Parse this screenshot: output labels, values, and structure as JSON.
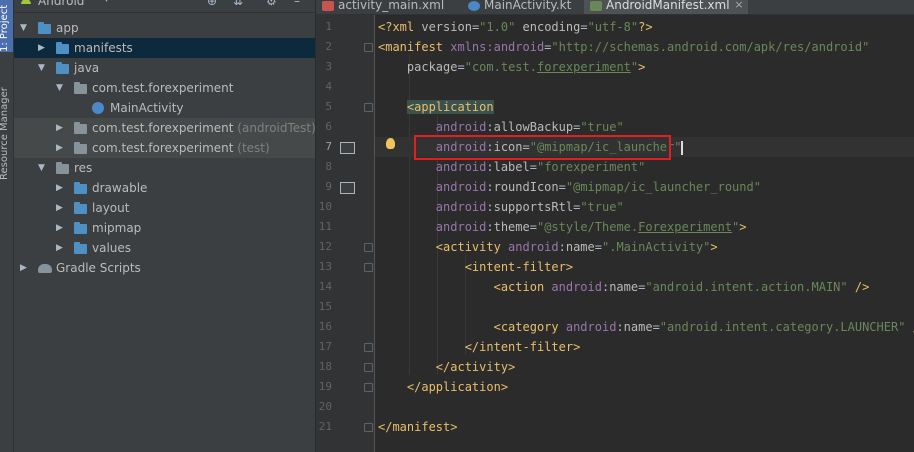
{
  "side_stripe": {
    "project_tab": "1: Project",
    "resource_manager_tab": "Resource Manager"
  },
  "project_panel": {
    "view_selector": "Android",
    "icons": [
      "globe-icon",
      "collapse-icon",
      "gear-icon",
      "hide-icon"
    ],
    "tree": [
      {
        "label": "app",
        "sub": "",
        "depth": 0,
        "expanded": true,
        "icon": "module-folder-icon",
        "state": "normal"
      },
      {
        "label": "manifests",
        "sub": "",
        "depth": 1,
        "expanded": false,
        "icon": "folder-icon",
        "state": "selected"
      },
      {
        "label": "java",
        "sub": "",
        "depth": 1,
        "expanded": true,
        "icon": "folder-icon",
        "state": "normal"
      },
      {
        "label": "com.test.forexperiment",
        "sub": "",
        "depth": 2,
        "expanded": true,
        "icon": "package-icon",
        "state": "normal"
      },
      {
        "label": "MainActivity",
        "sub": "",
        "depth": 3,
        "expanded": null,
        "icon": "kotlin-class-icon",
        "state": "normal"
      },
      {
        "label": "com.test.forexperiment",
        "sub": "(androidTest)",
        "depth": 2,
        "expanded": false,
        "icon": "package-icon",
        "state": "gray"
      },
      {
        "label": "com.test.forexperiment",
        "sub": "(test)",
        "depth": 2,
        "expanded": false,
        "icon": "package-icon",
        "state": "gray"
      },
      {
        "label": "res",
        "sub": "",
        "depth": 1,
        "expanded": true,
        "icon": "res-folder-icon",
        "state": "normal"
      },
      {
        "label": "drawable",
        "sub": "",
        "depth": 2,
        "expanded": false,
        "icon": "folder-icon",
        "state": "normal"
      },
      {
        "label": "layout",
        "sub": "",
        "depth": 2,
        "expanded": false,
        "icon": "folder-icon",
        "state": "normal"
      },
      {
        "label": "mipmap",
        "sub": "",
        "depth": 2,
        "expanded": false,
        "icon": "folder-icon",
        "state": "normal"
      },
      {
        "label": "values",
        "sub": "",
        "depth": 2,
        "expanded": false,
        "icon": "folder-icon",
        "state": "normal"
      },
      {
        "label": "Gradle Scripts",
        "sub": "",
        "depth": 0,
        "expanded": false,
        "icon": "gradle-icon",
        "state": "normal"
      }
    ]
  },
  "tabs": [
    {
      "label": "activity_main.xml",
      "icon": "xml-layout-icon",
      "active": false
    },
    {
      "label": "MainActivity.kt",
      "icon": "kotlin-file-icon",
      "active": false
    },
    {
      "label": "AndroidManifest.xml",
      "icon": "manifest-icon",
      "active": true
    }
  ],
  "colors": {
    "tag": "#e8bf6a",
    "namespace": "#9876aa",
    "attribute": "#bababa",
    "value": "#6a8759",
    "highlight_border": "#e02020",
    "selection": "#0d293e"
  },
  "code_lines": [
    {
      "n": "1",
      "parts": [
        [
          "t",
          "<?xml "
        ],
        [
          "at",
          "version"
        ],
        [
          "p",
          "="
        ],
        [
          "v",
          "\"1.0\""
        ],
        [
          "p",
          " "
        ],
        [
          "at",
          "encoding"
        ],
        [
          "p",
          "="
        ],
        [
          "v",
          "\"utf-8\""
        ],
        [
          "t",
          "?>"
        ]
      ]
    },
    {
      "n": "2",
      "parts": [
        [
          "t",
          "<manifest "
        ],
        [
          "ns",
          "xmlns:android"
        ],
        [
          "p",
          "="
        ],
        [
          "v",
          "\"http://schemas.android.com/apk/res/android\""
        ]
      ]
    },
    {
      "n": "3",
      "parts": [
        [
          "p",
          "    "
        ],
        [
          "at",
          "package"
        ],
        [
          "p",
          "="
        ],
        [
          "v",
          "\"com.test."
        ],
        [
          "vu",
          "forexperiment"
        ],
        [
          "v",
          "\""
        ],
        [
          "t",
          ">"
        ]
      ]
    },
    {
      "n": "4",
      "parts": []
    },
    {
      "n": "5",
      "parts": [
        [
          "p",
          "    "
        ],
        [
          "tb",
          "<application"
        ]
      ]
    },
    {
      "n": "6",
      "parts": [
        [
          "p",
          "        "
        ],
        [
          "ns",
          "android"
        ],
        [
          "p",
          ":"
        ],
        [
          "at",
          "allowBackup"
        ],
        [
          "p",
          "="
        ],
        [
          "v",
          "\"true\""
        ]
      ]
    },
    {
      "n": "7",
      "parts": [
        [
          "p",
          "        "
        ],
        [
          "ns",
          "android"
        ],
        [
          "p",
          ":"
        ],
        [
          "at",
          "icon"
        ],
        [
          "p",
          "="
        ],
        [
          "v",
          "\"@mipmap/ic_launcher\""
        ],
        [
          "caret",
          ""
        ]
      ]
    },
    {
      "n": "8",
      "parts": [
        [
          "p",
          "        "
        ],
        [
          "ns",
          "android"
        ],
        [
          "p",
          ":"
        ],
        [
          "at",
          "label"
        ],
        [
          "p",
          "="
        ],
        [
          "v",
          "\"forexperiment\""
        ]
      ]
    },
    {
      "n": "9",
      "parts": [
        [
          "p",
          "        "
        ],
        [
          "ns",
          "android"
        ],
        [
          "p",
          ":"
        ],
        [
          "at",
          "roundIcon"
        ],
        [
          "p",
          "="
        ],
        [
          "v",
          "\"@mipmap/ic_launcher_round\""
        ]
      ]
    },
    {
      "n": "10",
      "parts": [
        [
          "p",
          "        "
        ],
        [
          "ns",
          "android"
        ],
        [
          "p",
          ":"
        ],
        [
          "at",
          "supportsRtl"
        ],
        [
          "p",
          "="
        ],
        [
          "v",
          "\"true\""
        ]
      ]
    },
    {
      "n": "11",
      "parts": [
        [
          "p",
          "        "
        ],
        [
          "ns",
          "android"
        ],
        [
          "p",
          ":"
        ],
        [
          "at",
          "theme"
        ],
        [
          "p",
          "="
        ],
        [
          "v",
          "\"@style/Theme."
        ],
        [
          "vu",
          "Forexperiment"
        ],
        [
          "v",
          "\""
        ],
        [
          "t",
          ">"
        ]
      ]
    },
    {
      "n": "12",
      "parts": [
        [
          "p",
          "        "
        ],
        [
          "t",
          "<activity "
        ],
        [
          "ns",
          "android"
        ],
        [
          "p",
          ":"
        ],
        [
          "at",
          "name"
        ],
        [
          "p",
          "="
        ],
        [
          "v",
          "\".MainActivity\""
        ],
        [
          "t",
          ">"
        ]
      ]
    },
    {
      "n": "13",
      "parts": [
        [
          "p",
          "            "
        ],
        [
          "t",
          "<intent-filter>"
        ]
      ]
    },
    {
      "n": "14",
      "parts": [
        [
          "p",
          "                "
        ],
        [
          "t",
          "<action "
        ],
        [
          "ns",
          "android"
        ],
        [
          "p",
          ":"
        ],
        [
          "at",
          "name"
        ],
        [
          "p",
          "="
        ],
        [
          "v",
          "\"android.intent.action.MAIN\""
        ],
        [
          "p",
          " "
        ],
        [
          "t",
          "/>"
        ]
      ]
    },
    {
      "n": "15",
      "parts": []
    },
    {
      "n": "16",
      "parts": [
        [
          "p",
          "                "
        ],
        [
          "t",
          "<category "
        ],
        [
          "ns",
          "android"
        ],
        [
          "p",
          ":"
        ],
        [
          "at",
          "name"
        ],
        [
          "p",
          "="
        ],
        [
          "v",
          "\"android.intent.category.LAUNCHER\""
        ],
        [
          "p",
          " "
        ],
        [
          "t",
          "/>"
        ]
      ]
    },
    {
      "n": "17",
      "parts": [
        [
          "p",
          "            "
        ],
        [
          "t",
          "</intent-filter>"
        ]
      ]
    },
    {
      "n": "18",
      "parts": [
        [
          "p",
          "        "
        ],
        [
          "t",
          "</activity>"
        ]
      ]
    },
    {
      "n": "19",
      "parts": [
        [
          "p",
          "    "
        ],
        [
          "t",
          "</application>"
        ]
      ]
    },
    {
      "n": "20",
      "parts": []
    },
    {
      "n": "21",
      "parts": [
        [
          "t",
          "</manifest>"
        ]
      ]
    }
  ],
  "gutter_icons": {
    "7": "image-icon",
    "9": "image-icon"
  },
  "current_line": "7"
}
